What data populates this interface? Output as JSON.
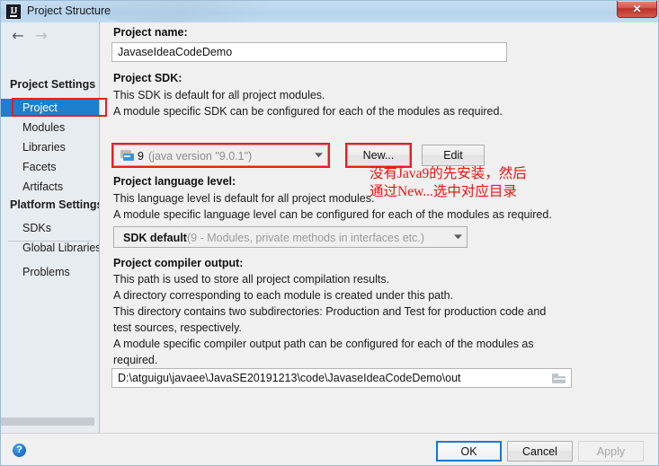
{
  "window": {
    "title": "Project Structure",
    "app_icon": "intellij-idea-icon",
    "close_label": "✕"
  },
  "sidebar": {
    "nav": {
      "back": "←",
      "forward": "→"
    },
    "groups": [
      {
        "header": "Project Settings",
        "items": [
          {
            "label": "Project",
            "selected": true
          },
          {
            "label": "Modules",
            "selected": false
          },
          {
            "label": "Libraries",
            "selected": false
          },
          {
            "label": "Facets",
            "selected": false
          },
          {
            "label": "Artifacts",
            "selected": false
          }
        ]
      },
      {
        "header": "Platform Settings",
        "items": [
          {
            "label": "SDKs",
            "selected": false
          },
          {
            "label": "Global Libraries",
            "selected": false
          }
        ]
      }
    ],
    "problems": "Problems"
  },
  "main": {
    "project_name": {
      "label": "Project name:",
      "value": "JavaseIdeaCodeDemo"
    },
    "project_sdk": {
      "label": "Project SDK:",
      "desc1": "This SDK is default for all project modules.",
      "desc2": "A module specific SDK can be configured for each of the modules as required.",
      "combo_value": "9",
      "combo_detail": "(java version \"9.0.1\")",
      "new_button": "New...",
      "edit_button": "Edit"
    },
    "language_level": {
      "label": "Project language level:",
      "desc1": "This language level is default for all project modules.",
      "desc2": "A module specific language level can be configured for each of the modules as required.",
      "combo_value": "SDK default",
      "combo_detail": "(9 - Modules, private methods in interfaces etc.)"
    },
    "compiler_output": {
      "label": "Project compiler output:",
      "desc1": "This path is used to store all project compilation results.",
      "desc2": "A directory corresponding to each module is created under this path.",
      "desc3": "This directory contains two subdirectories: Production and Test for production code and",
      "desc4": "test sources, respectively.",
      "desc5": "A module specific compiler output path can be configured for each of the modules as",
      "desc6": "required.",
      "value": "D:\\atguigu\\javaee\\JavaSE20191213\\code\\JavaseIdeaCodeDemo\\out"
    }
  },
  "annotation": {
    "line1": "没有Java9的先安装，然后",
    "line2": "通过New...选中对应目录",
    "color": "#ee1111"
  },
  "footer": {
    "help": "?",
    "ok": "OK",
    "cancel": "Cancel",
    "apply": "Apply"
  },
  "colors": {
    "selection_blue": "#1d7fce",
    "highlight_red": "#ee1c1c",
    "titlebar_blue": "#bbd6ee",
    "default_button_border": "#0a7bd4"
  }
}
